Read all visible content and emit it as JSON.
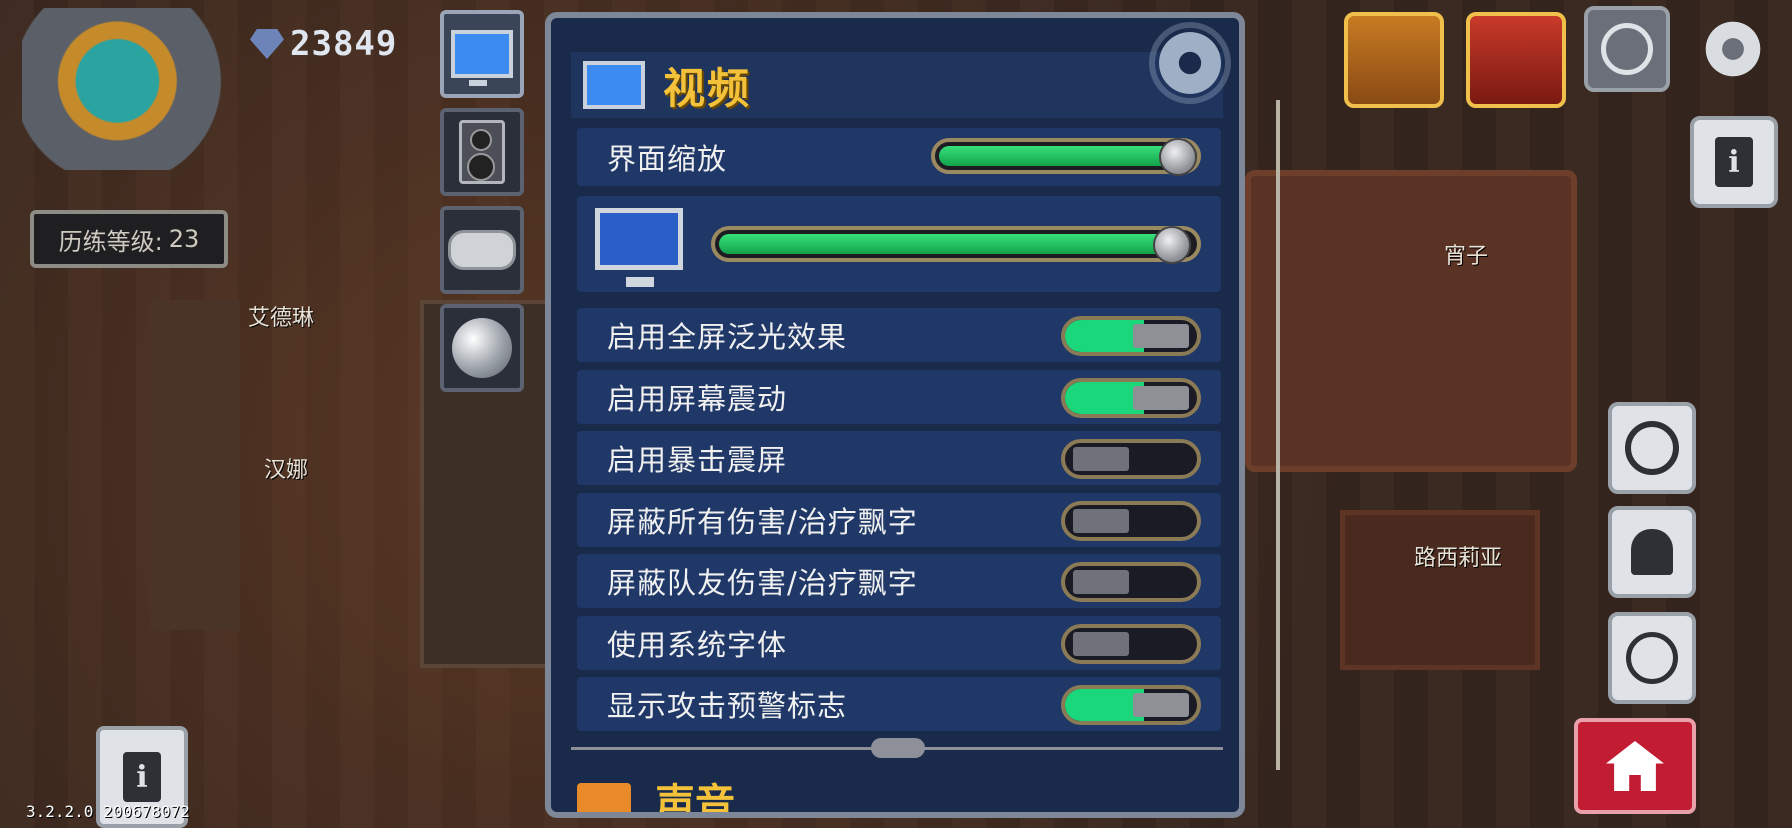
{
  "hud": {
    "gems": "23849",
    "level_label": "历练等级:",
    "level_value": "23",
    "version": "3.2.2.0 200678072"
  },
  "npcs": [
    "艾德琳",
    "汉娜",
    "宵子",
    "路西莉亚"
  ],
  "panel": {
    "title": "视频",
    "next_section_title": "声音",
    "ui_scale": {
      "label": "界面缩放",
      "value_fraction": 0.97
    },
    "display": {
      "value_fraction": 0.97
    },
    "toggles": [
      {
        "label": "启用全屏泛光效果",
        "on": true
      },
      {
        "label": "启用屏幕震动",
        "on": true
      },
      {
        "label": "启用暴击震屏",
        "on": false
      },
      {
        "label": "屏蔽所有伤害/治疗飘字",
        "on": false
      },
      {
        "label": "屏蔽队友伤害/治疗飘字",
        "on": false
      },
      {
        "label": "使用系统字体",
        "on": false
      },
      {
        "label": "显示攻击预警标志",
        "on": true
      }
    ]
  },
  "icons": {
    "tabs": [
      "monitor-icon",
      "speaker-icon",
      "gamepad-icon",
      "sphere-icon"
    ],
    "right_side": [
      "customer-service-icon",
      "settings-gear-icon",
      "info-book-icon",
      "sync-icon",
      "bell-icon",
      "headset-icon",
      "home-icon"
    ]
  }
}
